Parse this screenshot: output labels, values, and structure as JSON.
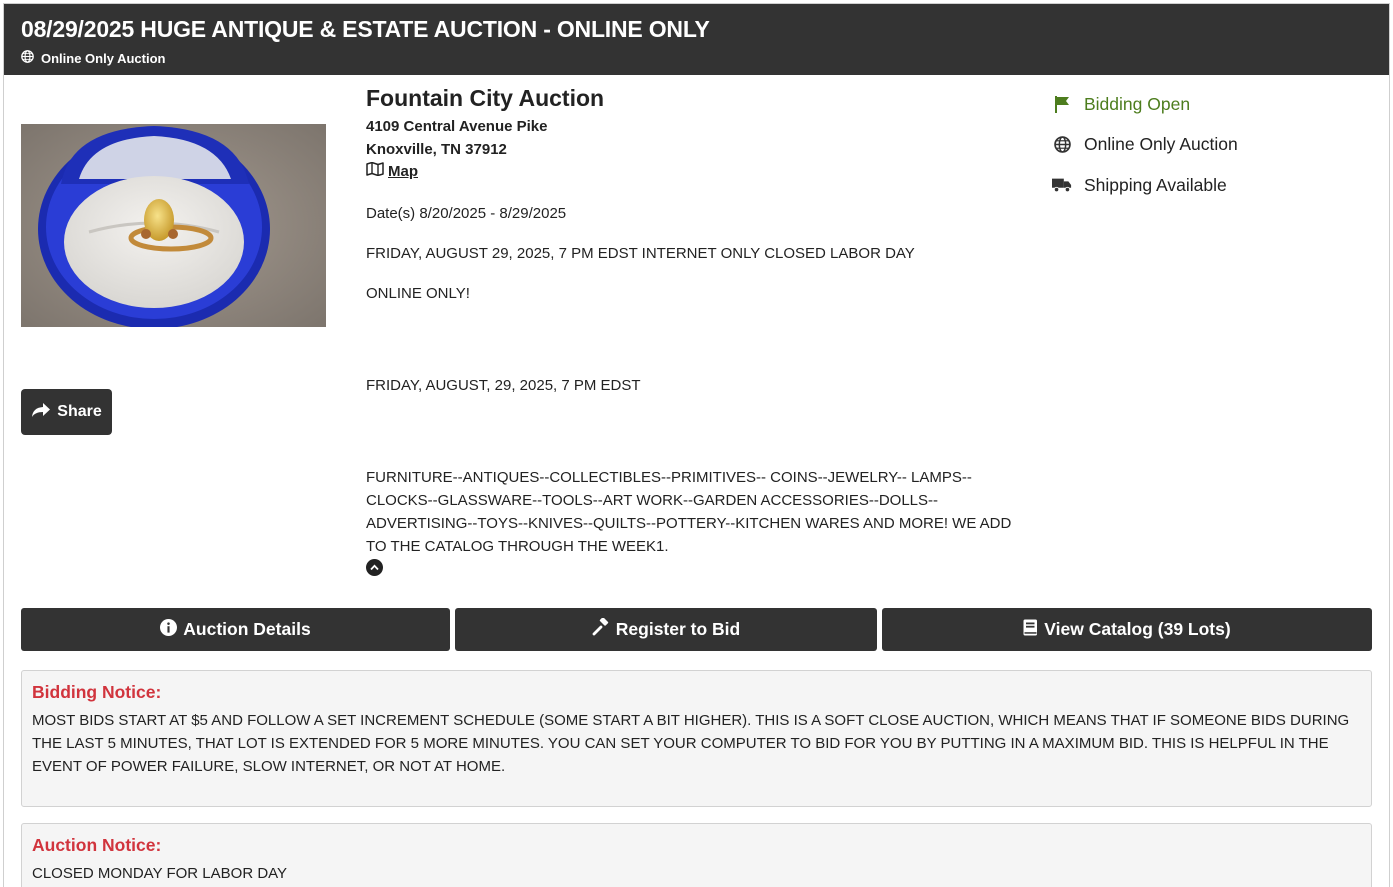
{
  "header": {
    "title": "08/29/2025 HUGE ANTIQUE & ESTATE AUCTION - ONLINE ONLY",
    "subtitle": "Online Only Auction"
  },
  "share": {
    "label": "Share"
  },
  "company": {
    "name": "Fountain City Auction",
    "address1": "4109 Central Avenue Pike",
    "address2": "Knoxville, TN 37912",
    "map_label": "Map"
  },
  "description": {
    "dates": "Date(s) 8/20/2025 - 8/29/2025",
    "line1": "FRIDAY, AUGUST 29, 2025, 7 PM EDST INTERNET ONLY CLOSED LABOR DAY",
    "line2": "ONLINE ONLY!",
    "line3": "FRIDAY, AUGUST, 29, 2025, 7 PM EDST",
    "line4": "FURNITURE--ANTIQUES--COLLECTIBLES--PRIMITIVES-- COINS--JEWELRY-- LAMPS--CLOCKS--GLASSWARE--TOOLS--ART WORK--GARDEN ACCESSORIES--DOLLS--ADVERTISING--TOYS--KNIVES--QUILTS--POTTERY--KITCHEN WARES AND MORE! WE ADD TO THE CATALOG THROUGH THE WEEK1."
  },
  "status": {
    "bidding": "Bidding Open",
    "type": "Online Only Auction",
    "shipping": "Shipping Available",
    "bidding_color": "#4d7d1e"
  },
  "actions": {
    "details": "Auction Details",
    "register": "Register to Bid",
    "catalog": "View Catalog (39 Lots)"
  },
  "notices": {
    "bidding_title": "Bidding Notice:",
    "bidding_text": "MOST BIDS START AT $5 AND FOLLOW A SET INCREMENT SCHEDULE (SOME START A BIT HIGHER). THIS IS A SOFT CLOSE AUCTION, WHICH MEANS THAT IF SOMEONE BIDS DURING THE LAST 5 MINUTES, THAT LOT IS EXTENDED FOR 5 MORE MINUTES. YOU CAN SET YOUR COMPUTER TO BID FOR YOU BY PUTTING IN A MAXIMUM BID. THIS IS HELPFUL IN THE EVENT OF POWER FAILURE, SLOW INTERNET, OR NOT AT HOME.",
    "auction_title": "Auction Notice:",
    "auction_text": "CLOSED MONDAY FOR LABOR DAY",
    "title_color": "#d1343d"
  }
}
